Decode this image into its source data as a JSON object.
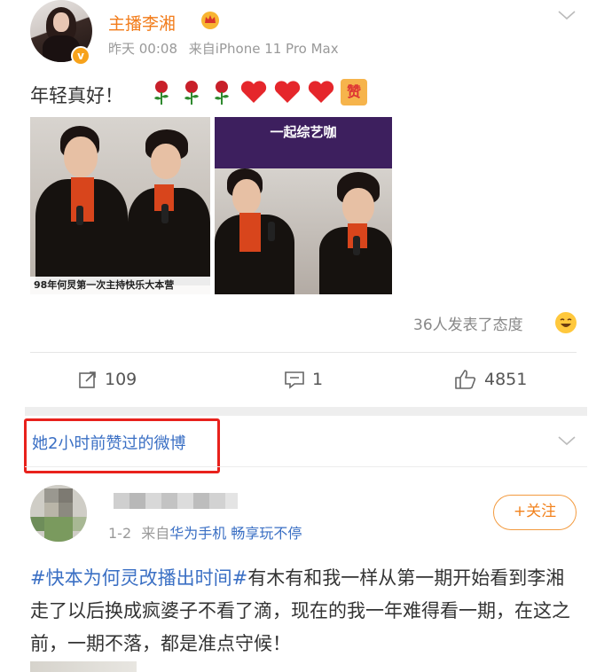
{
  "post": {
    "username": "主播李湘",
    "time": "昨天 00:08",
    "source_prefix": "来自",
    "source_device": "iPhone 11 Pro Max",
    "text": "年轻真好！",
    "emoji_names": [
      "rose-icon",
      "rose-icon",
      "rose-icon",
      "heart-icon",
      "heart-icon",
      "heart-icon",
      "zan-sticker"
    ],
    "zan_glyph": "赞",
    "verified_glyph": "v",
    "images": [
      {
        "caption": "98年何炅第一次主持快乐大本营"
      },
      {
        "title": "一起综艺咖"
      }
    ],
    "approvals_text": "36人发表了态度"
  },
  "actions": {
    "repost_count": "109",
    "comment_count": "1",
    "like_count": "4851"
  },
  "liked_section": {
    "title": "她2小时前赞过的微博"
  },
  "liked_post": {
    "time": "1-2",
    "source_prefix": "来自",
    "source": "华为手机 畅享玩不停",
    "follow_label": "+关注",
    "hashtag": "#快本为何灵改播出时间#",
    "text": "有木有和我一样从第一期开始看到李湘走了以后换成疯婆子不看了滴，现在的我一年难得看一期，在这之前，一期不落，都是准点守候！"
  },
  "colors": {
    "username": "#f27c1b",
    "link": "#3a6fc4",
    "highlight_box": "#e8211c",
    "follow": "#f2821d"
  }
}
